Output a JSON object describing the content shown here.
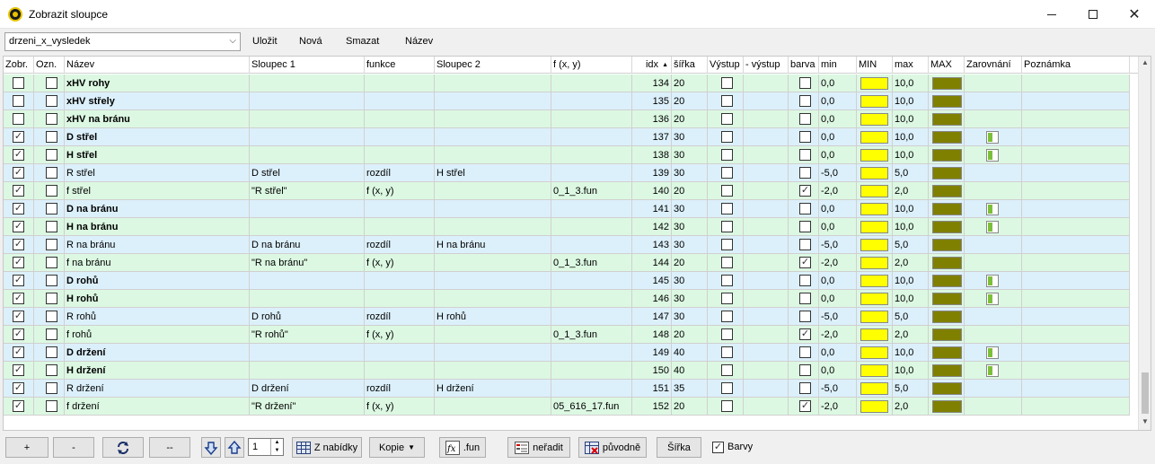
{
  "window": {
    "title": "Zobrazit sloupce",
    "minimize_icon": "minimize-icon",
    "maximize_icon": "maximize-icon",
    "close_icon": "close-icon"
  },
  "toolbar": {
    "preset_value": "drzeni_x_vysledek",
    "save_label": "Uložit",
    "new_label": "Nová",
    "delete_label": "Smazat",
    "name_label": "Název"
  },
  "columns": [
    {
      "key": "zobr",
      "label": "Zobr."
    },
    {
      "key": "ozn",
      "label": "Ozn."
    },
    {
      "key": "nazev",
      "label": "Název"
    },
    {
      "key": "sloupec1",
      "label": "Sloupec 1"
    },
    {
      "key": "funkce",
      "label": "funkce"
    },
    {
      "key": "sloupec2",
      "label": "Sloupec 2"
    },
    {
      "key": "fxy",
      "label": "f (x, y)"
    },
    {
      "key": "idx",
      "label": "idx"
    },
    {
      "key": "sirka",
      "label": "šířka"
    },
    {
      "key": "vystup",
      "label": "Výstup"
    },
    {
      "key": "minus_vystup",
      "label": "- výstup"
    },
    {
      "key": "barva",
      "label": "barva"
    },
    {
      "key": "min",
      "label": "min"
    },
    {
      "key": "MIN",
      "label": "MIN"
    },
    {
      "key": "max",
      "label": "max"
    },
    {
      "key": "MAX",
      "label": "MAX"
    },
    {
      "key": "zarovnani",
      "label": "Zarovnání"
    },
    {
      "key": "poznamka",
      "label": "Poznámka"
    }
  ],
  "sort": {
    "column": "idx",
    "direction": "ascending"
  },
  "colors": {
    "row_blue": "#dcf0fb",
    "row_green": "#dcf8e2",
    "min_swatch": "#ffff00",
    "max_swatch": "#808000"
  },
  "rows": [
    {
      "zobr": false,
      "ozn": false,
      "nazev": "xHV rohy",
      "bold": true,
      "sloupec1": "",
      "funkce": "",
      "sloupec2": "",
      "fxy": "",
      "idx": "134",
      "sirka": "20",
      "vystup": false,
      "barva": false,
      "min": "0,0",
      "max": "10,0",
      "align_icon": false,
      "tone": "green"
    },
    {
      "zobr": false,
      "ozn": false,
      "nazev": "xHV střely",
      "bold": true,
      "sloupec1": "",
      "funkce": "",
      "sloupec2": "",
      "fxy": "",
      "idx": "135",
      "sirka": "20",
      "vystup": false,
      "barva": false,
      "min": "0,0",
      "max": "10,0",
      "align_icon": false,
      "tone": "blue"
    },
    {
      "zobr": false,
      "ozn": false,
      "nazev": "xHV na bránu",
      "bold": true,
      "sloupec1": "",
      "funkce": "",
      "sloupec2": "",
      "fxy": "",
      "idx": "136",
      "sirka": "20",
      "vystup": false,
      "barva": false,
      "min": "0,0",
      "max": "10,0",
      "align_icon": false,
      "tone": "green"
    },
    {
      "zobr": true,
      "ozn": false,
      "nazev": "D střel",
      "bold": true,
      "sloupec1": "",
      "funkce": "",
      "sloupec2": "",
      "fxy": "",
      "idx": "137",
      "sirka": "30",
      "vystup": false,
      "barva": false,
      "min": "0,0",
      "max": "10,0",
      "align_icon": true,
      "tone": "blue"
    },
    {
      "zobr": true,
      "ozn": false,
      "nazev": "H střel",
      "bold": true,
      "sloupec1": "",
      "funkce": "",
      "sloupec2": "",
      "fxy": "",
      "idx": "138",
      "sirka": "30",
      "vystup": false,
      "barva": false,
      "min": "0,0",
      "max": "10,0",
      "align_icon": true,
      "tone": "green"
    },
    {
      "zobr": true,
      "ozn": false,
      "nazev": "R střel",
      "bold": false,
      "sloupec1": "D střel",
      "funkce": "rozdíl",
      "sloupec2": "H střel",
      "fxy": "",
      "idx": "139",
      "sirka": "30",
      "vystup": false,
      "barva": false,
      "min": "-5,0",
      "max": "5,0",
      "align_icon": false,
      "tone": "blue"
    },
    {
      "zobr": true,
      "ozn": false,
      "nazev": "f střel",
      "bold": false,
      "sloupec1": "\"R střel\"",
      "funkce": "f (x, y)",
      "sloupec2": "",
      "fxy": "0_1_3.fun",
      "idx": "140",
      "sirka": "20",
      "vystup": false,
      "barva": true,
      "min": "-2,0",
      "max": "2,0",
      "align_icon": false,
      "tone": "green"
    },
    {
      "zobr": true,
      "ozn": false,
      "nazev": "D na bránu",
      "bold": true,
      "sloupec1": "",
      "funkce": "",
      "sloupec2": "",
      "fxy": "",
      "idx": "141",
      "sirka": "30",
      "vystup": false,
      "barva": false,
      "min": "0,0",
      "max": "10,0",
      "align_icon": true,
      "tone": "blue"
    },
    {
      "zobr": true,
      "ozn": false,
      "nazev": "H na bránu",
      "bold": true,
      "sloupec1": "",
      "funkce": "",
      "sloupec2": "",
      "fxy": "",
      "idx": "142",
      "sirka": "30",
      "vystup": false,
      "barva": false,
      "min": "0,0",
      "max": "10,0",
      "align_icon": true,
      "tone": "green"
    },
    {
      "zobr": true,
      "ozn": false,
      "nazev": "R na bránu",
      "bold": false,
      "sloupec1": "D na bránu",
      "funkce": "rozdíl",
      "sloupec2": "H na bránu",
      "fxy": "",
      "idx": "143",
      "sirka": "30",
      "vystup": false,
      "barva": false,
      "min": "-5,0",
      "max": "5,0",
      "align_icon": false,
      "tone": "blue"
    },
    {
      "zobr": true,
      "ozn": false,
      "nazev": "f na bránu",
      "bold": false,
      "sloupec1": "\"R na bránu\"",
      "funkce": "f (x, y)",
      "sloupec2": "",
      "fxy": "0_1_3.fun",
      "idx": "144",
      "sirka": "20",
      "vystup": false,
      "barva": true,
      "min": "-2,0",
      "max": "2,0",
      "align_icon": false,
      "tone": "green"
    },
    {
      "zobr": true,
      "ozn": false,
      "nazev": "D rohů",
      "bold": true,
      "sloupec1": "",
      "funkce": "",
      "sloupec2": "",
      "fxy": "",
      "idx": "145",
      "sirka": "30",
      "vystup": false,
      "barva": false,
      "min": "0,0",
      "max": "10,0",
      "align_icon": true,
      "tone": "blue"
    },
    {
      "zobr": true,
      "ozn": false,
      "nazev": "H rohů",
      "bold": true,
      "sloupec1": "",
      "funkce": "",
      "sloupec2": "",
      "fxy": "",
      "idx": "146",
      "sirka": "30",
      "vystup": false,
      "barva": false,
      "min": "0,0",
      "max": "10,0",
      "align_icon": true,
      "tone": "green"
    },
    {
      "zobr": true,
      "ozn": false,
      "nazev": "R rohů",
      "bold": false,
      "sloupec1": "D rohů",
      "funkce": "rozdíl",
      "sloupec2": "H rohů",
      "fxy": "",
      "idx": "147",
      "sirka": "30",
      "vystup": false,
      "barva": false,
      "min": "-5,0",
      "max": "5,0",
      "align_icon": false,
      "tone": "blue"
    },
    {
      "zobr": true,
      "ozn": false,
      "nazev": "f rohů",
      "bold": false,
      "sloupec1": "\"R rohů\"",
      "funkce": "f (x, y)",
      "sloupec2": "",
      "fxy": "0_1_3.fun",
      "idx": "148",
      "sirka": "20",
      "vystup": false,
      "barva": true,
      "min": "-2,0",
      "max": "2,0",
      "align_icon": false,
      "tone": "green"
    },
    {
      "zobr": true,
      "ozn": false,
      "nazev": "D držení",
      "bold": true,
      "sloupec1": "",
      "funkce": "",
      "sloupec2": "",
      "fxy": "",
      "idx": "149",
      "sirka": "40",
      "vystup": false,
      "barva": false,
      "min": "0,0",
      "max": "10,0",
      "align_icon": true,
      "tone": "blue"
    },
    {
      "zobr": true,
      "ozn": false,
      "nazev": "H držení",
      "bold": true,
      "sloupec1": "",
      "funkce": "",
      "sloupec2": "",
      "fxy": "",
      "idx": "150",
      "sirka": "40",
      "vystup": false,
      "barva": false,
      "min": "0,0",
      "max": "10,0",
      "align_icon": true,
      "tone": "green"
    },
    {
      "zobr": true,
      "ozn": false,
      "nazev": "R držení",
      "bold": false,
      "sloupec1": "D držení",
      "funkce": "rozdíl",
      "sloupec2": "H držení",
      "fxy": "",
      "idx": "151",
      "sirka": "35",
      "vystup": false,
      "barva": false,
      "min": "-5,0",
      "max": "5,0",
      "align_icon": false,
      "tone": "blue"
    },
    {
      "zobr": true,
      "ozn": false,
      "nazev": "f držení",
      "bold": false,
      "sloupec1": "\"R držení\"",
      "funkce": "f (x, y)",
      "sloupec2": "",
      "fxy": "05_616_17.fun",
      "idx": "152",
      "sirka": "20",
      "vystup": false,
      "barva": true,
      "min": "-2,0",
      "max": "2,0",
      "align_icon": false,
      "tone": "green"
    }
  ],
  "bottombar": {
    "plus_label": "+",
    "minus_label": "-",
    "double_minus_label": "--",
    "refresh_icon": "refresh-icon",
    "move_down_icon": "arrow-down-icon",
    "move_up_icon": "arrow-up-icon",
    "step_value": "1",
    "from_menu_label": "Z nabídky",
    "copy_label": "Kopie",
    "fun_label": ".fun",
    "unsort_label": "neřadit",
    "original_label": "původně",
    "width_label": "Šířka",
    "colors_label": "Barvy",
    "colors_checked": true
  }
}
